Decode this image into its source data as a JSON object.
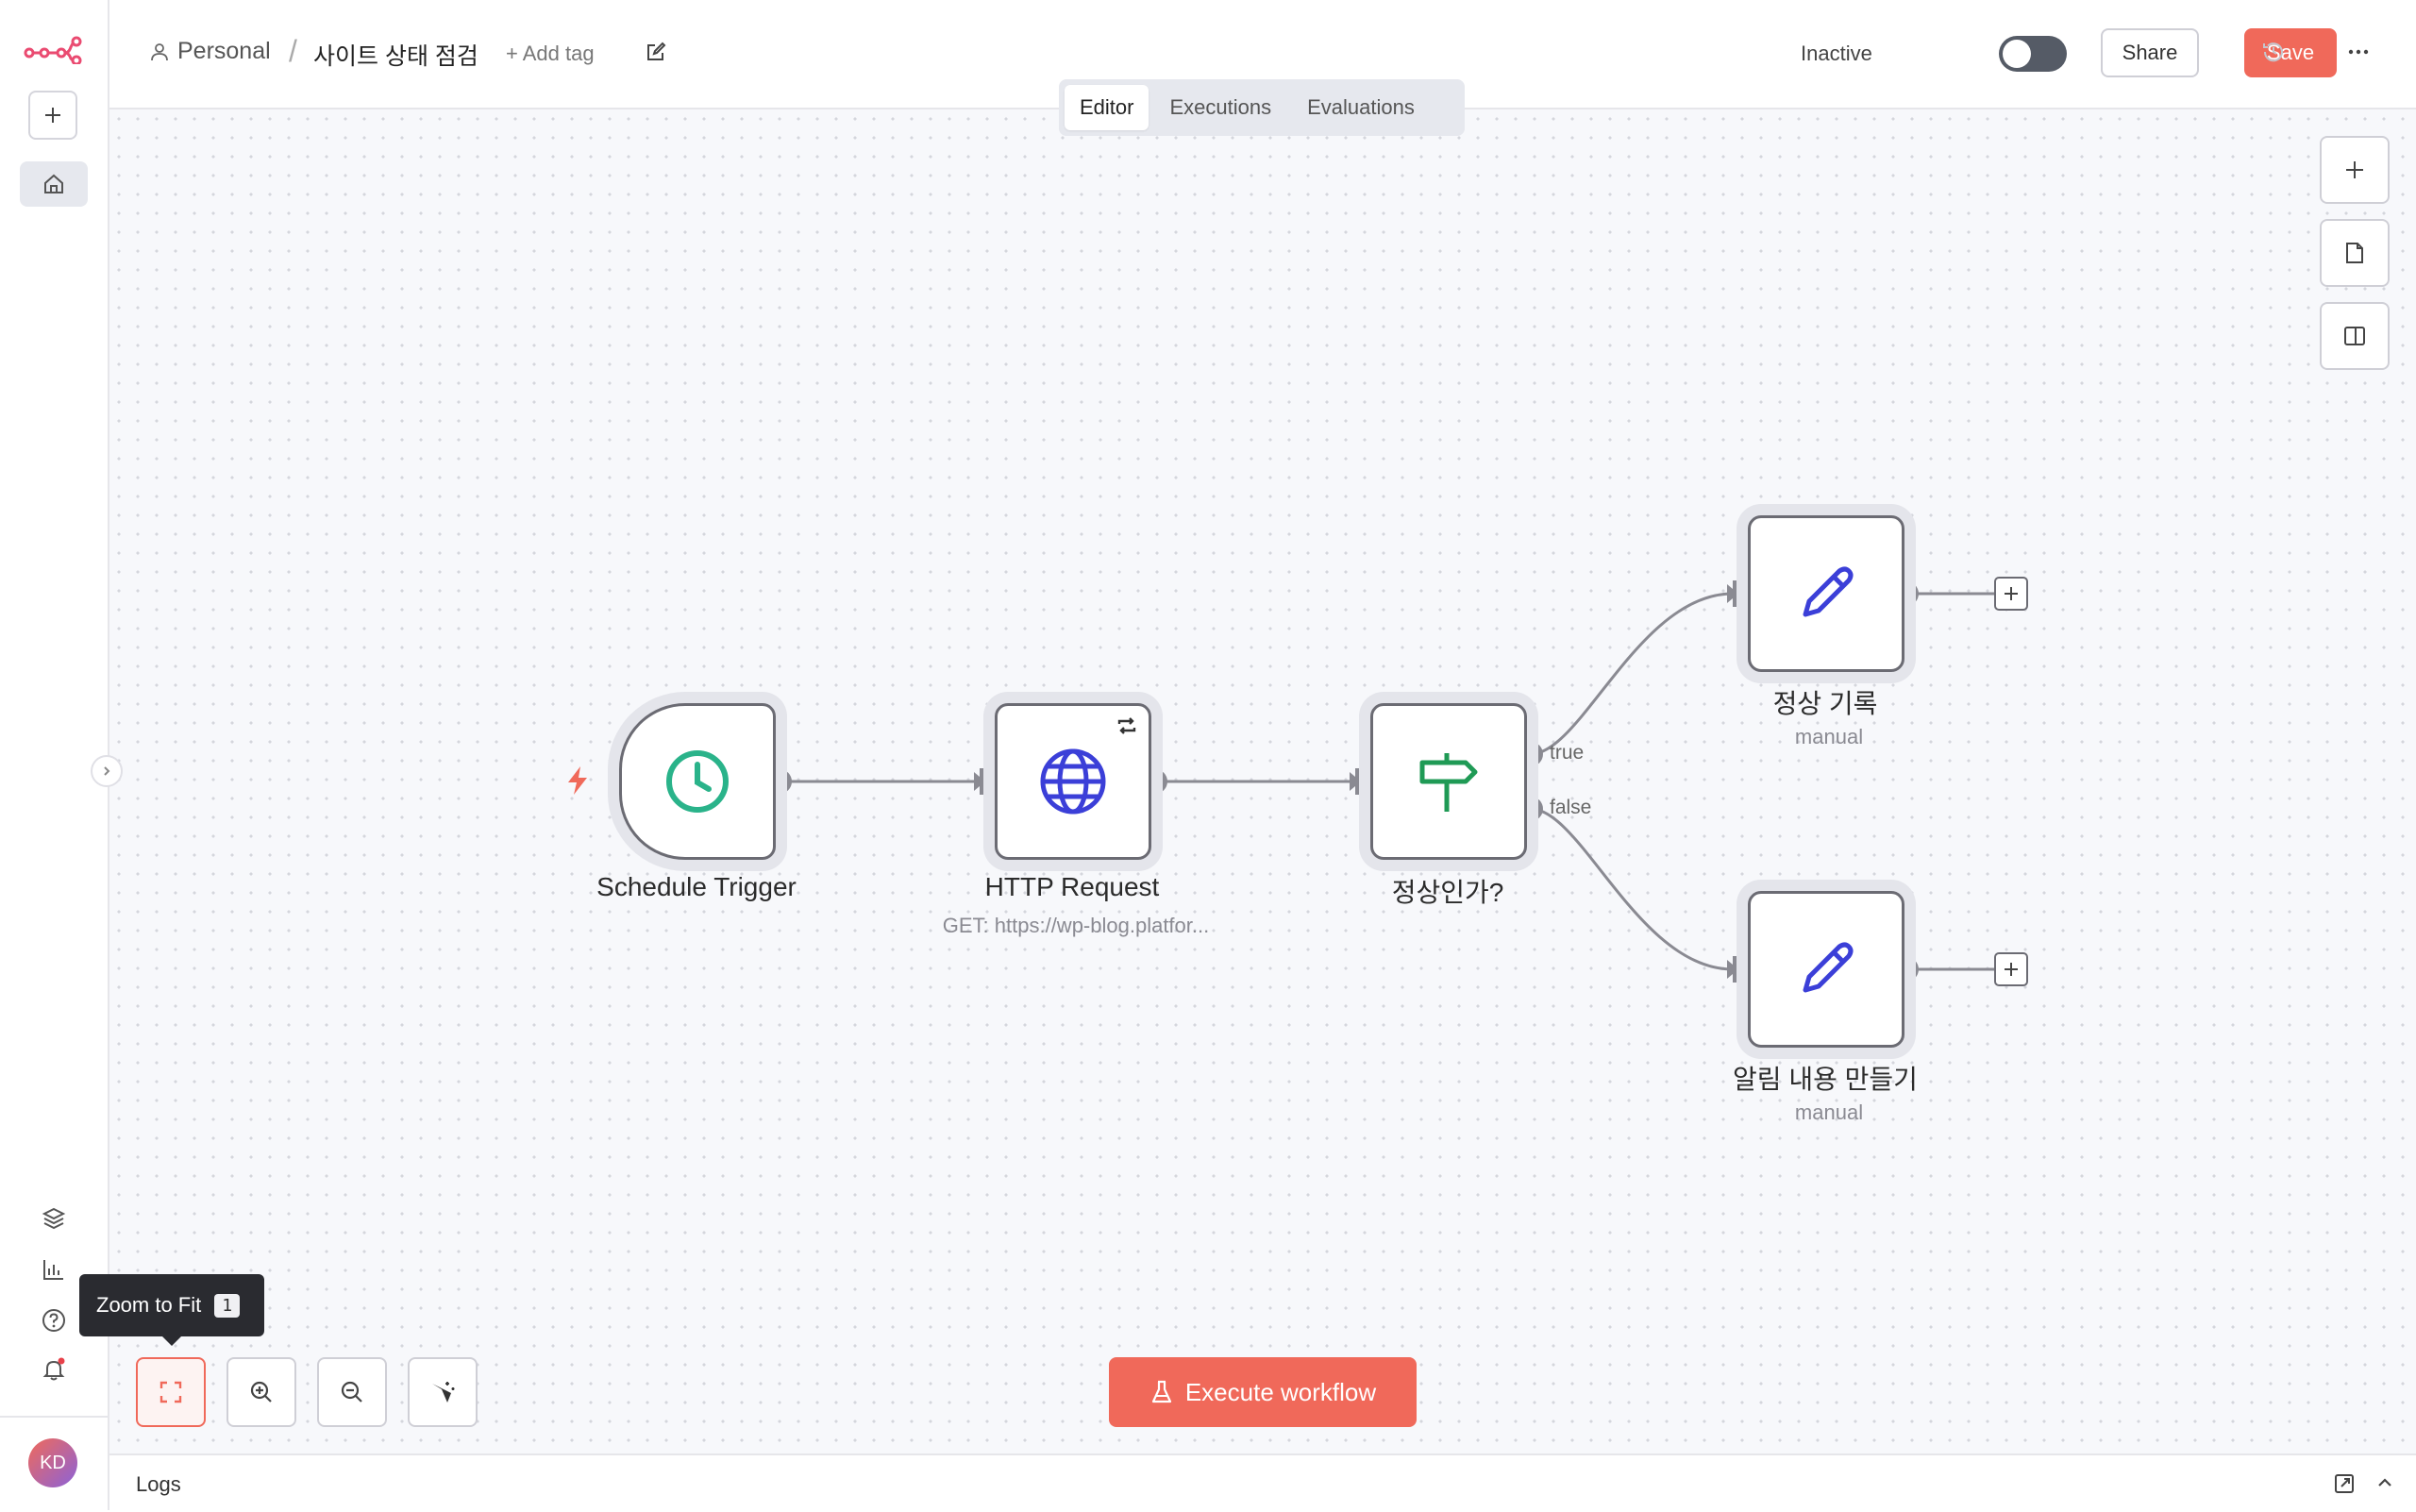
{
  "breadcrumb": {
    "project": "Personal",
    "separator": "/",
    "workflow_name": "사이트 상태 점검",
    "add_tag": "+ Add tag"
  },
  "header": {
    "status_label": "Inactive",
    "active": false,
    "share_label": "Share",
    "save_label": "Save"
  },
  "tabs": [
    {
      "label": "Editor",
      "active": true
    },
    {
      "label": "Executions",
      "active": false
    },
    {
      "label": "Evaluations",
      "active": false
    }
  ],
  "nodes": {
    "schedule": {
      "label": "Schedule Trigger"
    },
    "http": {
      "label": "HTTP Request",
      "subtitle": "GET: https://wp-blog.platfor..."
    },
    "if": {
      "label": "정상인가?",
      "true_label": "true",
      "false_label": "false"
    },
    "record": {
      "label": "정상 기록",
      "subtitle": "manual"
    },
    "alert": {
      "label": "알림 내용 만들기",
      "subtitle": "manual"
    }
  },
  "tooltip": {
    "text": "Zoom to Fit",
    "shortcut": "1"
  },
  "execute_label": "Execute workflow",
  "logs_label": "Logs",
  "user": {
    "initials": "KD"
  },
  "colors": {
    "accent": "#f0695a",
    "clock_green": "#2ab38a",
    "globe_blue": "#3b3fd8",
    "signpost_green": "#1f9a55",
    "node_border": "#6b6b73"
  },
  "icons": {
    "sidebar": [
      "add-icon",
      "home-icon",
      "templates-icon",
      "insights-icon",
      "help-icon",
      "bell-icon"
    ],
    "canvas_tools": [
      "plus-icon",
      "sticky-note-icon",
      "panel-icon"
    ],
    "zoom_controls": [
      "zoom-to-fit-icon",
      "zoom-in-icon",
      "zoom-out-icon",
      "tidy-up-icon"
    ]
  }
}
